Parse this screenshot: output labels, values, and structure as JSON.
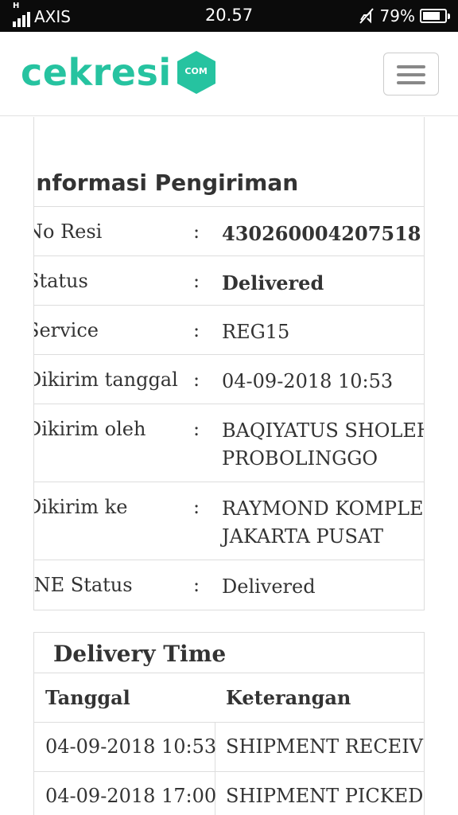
{
  "status_bar": {
    "signal_label": "H",
    "carrier": "AXIS",
    "time": "20.57",
    "battery_percent": "79%",
    "battery_level": 0.79
  },
  "navbar": {
    "logo_text": "cekresi",
    "logo_badge": "COM",
    "brand_color": "#26c3a0"
  },
  "info": {
    "title": "Informasi Pengiriman",
    "rows": [
      {
        "label": "No Resi",
        "colon": ":",
        "value": "430260004207518",
        "value2": ""
      },
      {
        "label": "Status",
        "colon": ":",
        "value": "Delivered",
        "value2": ""
      },
      {
        "label": "Service",
        "colon": ":",
        "value": "REG15",
        "value2": ""
      },
      {
        "label": "Dikirim tanggal",
        "colon": ":",
        "value": "04-09-2018 10:53",
        "value2": ""
      },
      {
        "label": "Dikirim oleh",
        "colon": ":",
        "value": "BAQIYATUS SHOLEHAH",
        "value2": "PROBOLINGGO"
      },
      {
        "label": "Dikirim ke",
        "colon": ":",
        "value": "RAYMOND KOMPLEK",
        "value2": "JAKARTA PUSAT"
      },
      {
        "label": "JNE Status",
        "colon": ":",
        "value": "Delivered",
        "value2": ""
      }
    ]
  },
  "delivery": {
    "title": "Delivery Time",
    "headers": {
      "date": "Tanggal",
      "desc": "Keterangan"
    },
    "rows": [
      {
        "date": "04-09-2018 10:53",
        "desc": "SHIPMENT RECEIVED"
      },
      {
        "date": "04-09-2018 17:00",
        "desc": "SHIPMENT PICKED UP"
      }
    ]
  }
}
